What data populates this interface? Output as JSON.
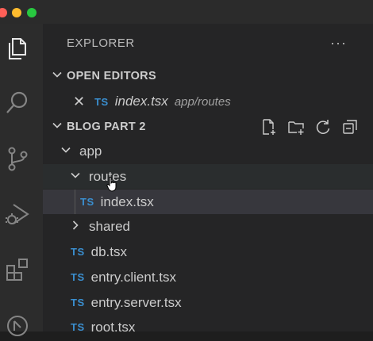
{
  "explorer": {
    "title": "EXPLORER",
    "more": "···"
  },
  "open_editors": {
    "header": "OPEN EDITORS",
    "items": [
      {
        "icon": "TS",
        "name": "index.tsx",
        "path": "app/routes"
      }
    ]
  },
  "project": {
    "header": "BLOG PART 2",
    "actions": [
      "new-file-icon",
      "new-folder-icon",
      "refresh-icon",
      "collapse-all-icon"
    ],
    "tree": {
      "app": "app",
      "routes": "routes",
      "routes_index_icon": "TS",
      "routes_index": "index.tsx",
      "shared": "shared",
      "db_icon": "TS",
      "db": "db.tsx",
      "entry_client_icon": "TS",
      "entry_client": "entry.client.tsx",
      "entry_server_icon": "TS",
      "entry_server": "entry.server.tsx",
      "root_icon": "TS",
      "root": "root.tsx"
    }
  },
  "activity_bar": [
    "files-icon",
    "search-icon",
    "source-control-icon",
    "run-debug-icon",
    "extensions-icon",
    "remote-icon"
  ]
}
